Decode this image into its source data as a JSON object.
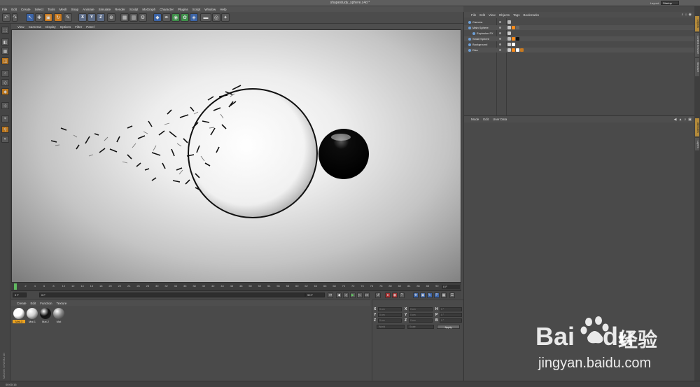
{
  "window": {
    "title": "shapestudy_sphere.c4d *",
    "layout_label": "Layout:",
    "layout_value": "Startup"
  },
  "menubar": [
    "File",
    "Edit",
    "Create",
    "Select",
    "Tools",
    "Mesh",
    "Snap",
    "Animate",
    "Simulate",
    "Render",
    "Sculpt",
    "MoGraph",
    "Character",
    "Plugins",
    "Script",
    "Window",
    "Help"
  ],
  "viewport_menu": [
    "View",
    "Cameras",
    "Display",
    "Options",
    "Filter",
    "Panel"
  ],
  "timeline": {
    "ticks": [
      "0",
      "2",
      "4",
      "6",
      "8",
      "10",
      "12",
      "14",
      "16",
      "18",
      "20",
      "22",
      "24",
      "26",
      "28",
      "30",
      "32",
      "34",
      "36",
      "38",
      "40",
      "42",
      "44",
      "46",
      "48",
      "50",
      "52",
      "54",
      "56",
      "58",
      "60",
      "62",
      "64",
      "66",
      "68",
      "70",
      "72",
      "74",
      "76",
      "78",
      "80",
      "82",
      "84",
      "86",
      "88",
      "90"
    ],
    "end_frame": "0 F",
    "current_frame": "0 F",
    "start_field": "0 F",
    "max_field": "90 F",
    "progress": 0
  },
  "material_menu": [
    "Create",
    "Edit",
    "Function",
    "Texture"
  ],
  "materials": [
    {
      "label": "Mat.3",
      "color": "#ffffff",
      "selected": true
    },
    {
      "label": "Mat.1",
      "color": "#cfcfcf",
      "selected": false
    },
    {
      "label": "Mat.2",
      "color": "#111111",
      "selected": false
    },
    {
      "label": "Mat",
      "color": "#888888",
      "selected": false
    }
  ],
  "coords": {
    "rows": [
      {
        "axis": "X",
        "pos": "0 cm",
        "size": "0 cm",
        "rot_label": "H",
        "rot": "0 °"
      },
      {
        "axis": "Y",
        "pos": "0 cm",
        "size": "0 cm",
        "rot_label": "P",
        "rot": "0 °"
      },
      {
        "axis": "Z",
        "pos": "0 cm",
        "size": "0 cm",
        "rot_label": "B",
        "rot": "0 °"
      }
    ],
    "mode": "World",
    "scale": "Scale",
    "apply": "Apply"
  },
  "object_menu": [
    "File",
    "Edit",
    "View",
    "Objects",
    "Tags",
    "Bookmarks"
  ],
  "objects": [
    {
      "name": "Camera",
      "indent": 0
    },
    {
      "name": "Main Sphere",
      "indent": 0
    },
    {
      "name": "Explosion FX",
      "indent": 1
    },
    {
      "name": "Small Sphere",
      "indent": 0
    },
    {
      "name": "Background",
      "indent": 0
    },
    {
      "name": "Disc",
      "indent": 0
    }
  ],
  "attr_menu": [
    "Mode",
    "Edit",
    "User Data"
  ],
  "side_tabs": [
    "Objects",
    "Content Browser",
    "Structure",
    "Attributes",
    "Layers"
  ],
  "status": "00:00:16",
  "watermark": {
    "brand": "Bai",
    "brand2": "du",
    "jingyan": "经验",
    "url": "jingyan.baidu.com"
  },
  "maxon": "MAXON CINEMA 4D"
}
